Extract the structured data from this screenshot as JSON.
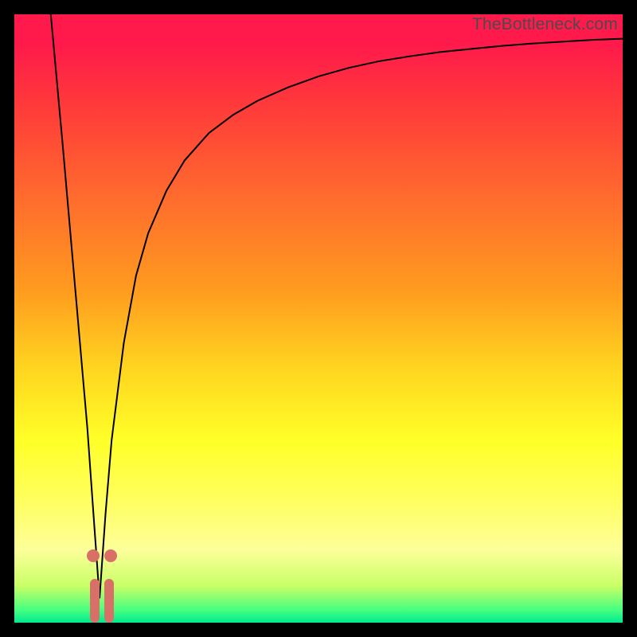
{
  "watermark": "TheBottleneck.com",
  "colors": {
    "curve": "#000000",
    "marker": "#d97068"
  },
  "chart_data": {
    "type": "line",
    "title": "",
    "xlabel": "",
    "ylabel": "",
    "x_range": [
      0,
      100
    ],
    "y_range": [
      0,
      100
    ],
    "note": "Values are read as percentages of the visible plot area; high y = top (more bottleneck). The curve forms a V with minimum near x≈14.",
    "series": [
      {
        "name": "bottleneck-curve",
        "x": [
          6,
          8,
          10,
          12,
          13,
          14,
          15,
          16,
          18,
          20,
          22,
          25,
          28,
          32,
          36,
          40,
          45,
          50,
          55,
          60,
          65,
          70,
          75,
          80,
          85,
          90,
          95,
          100
        ],
        "y": [
          100,
          78,
          55,
          32,
          18,
          4,
          18,
          30,
          46,
          57,
          64,
          71,
          76,
          80.5,
          83.5,
          85.8,
          88,
          89.8,
          91.2,
          92.3,
          93.1,
          93.8,
          94.3,
          94.8,
          95.2,
          95.5,
          95.8,
          96
        ]
      }
    ],
    "markers": [
      {
        "name": "left-dot",
        "x": 12.9,
        "y": 11
      },
      {
        "name": "right-dot",
        "x": 15.9,
        "y": 11
      }
    ],
    "bars_at_bottom": [
      {
        "name": "left-bar",
        "x": 13.2,
        "height_pct": 7.2
      },
      {
        "name": "right-bar",
        "x": 15.6,
        "height_pct": 7.2
      }
    ]
  }
}
